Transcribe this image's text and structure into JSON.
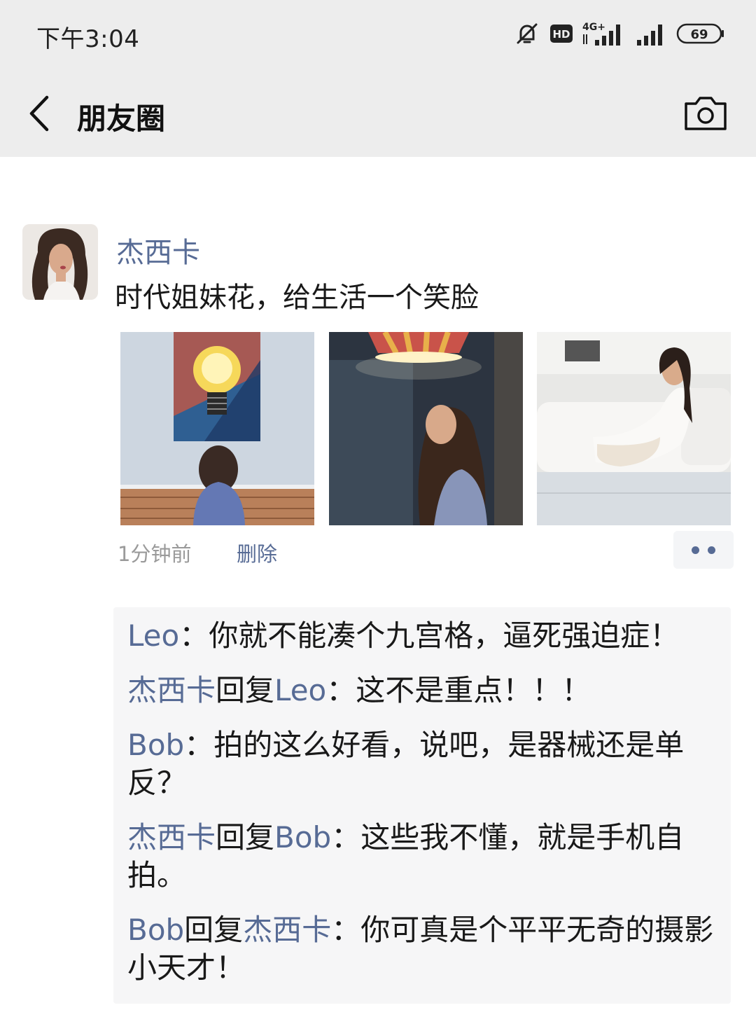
{
  "status_bar": {
    "time": "下午3:04",
    "hd": "HD",
    "network": "4G+",
    "battery": "69"
  },
  "nav": {
    "title": "朋友圈",
    "back_icon": "chevron-left-icon",
    "camera_icon": "camera-icon"
  },
  "post": {
    "author": "杰西卡",
    "text": "时代姐妹花，给生活一个笑脸",
    "time": "1分钟前",
    "delete_label": "删除",
    "more_icon": "more-dots-icon"
  },
  "comments": [
    {
      "from": "Leo",
      "colon": "：",
      "text": "你就不能凑个九宫格，逼死强迫症！"
    },
    {
      "from": "杰西卡",
      "reply_word": "回复",
      "to": "Leo",
      "colon": "：",
      "text": "这不是重点！！！"
    },
    {
      "from": "Bob",
      "colon": "：",
      "text": "拍的这么好看，说吧，是器械还是单反？"
    },
    {
      "from": "杰西卡",
      "reply_word": "回复",
      "to": "Bob",
      "colon": "：",
      "text": "这些我不懂，就是手机自拍。"
    },
    {
      "from": "Bob",
      "reply_word": "回复",
      "to": "杰西卡",
      "colon": "：",
      "text": "你可真是个平平无奇的摄影小天才！"
    }
  ],
  "colors": {
    "link_blue": "#576b95",
    "bar_gray": "#ededed",
    "comment_bg": "#f6f6f7"
  }
}
